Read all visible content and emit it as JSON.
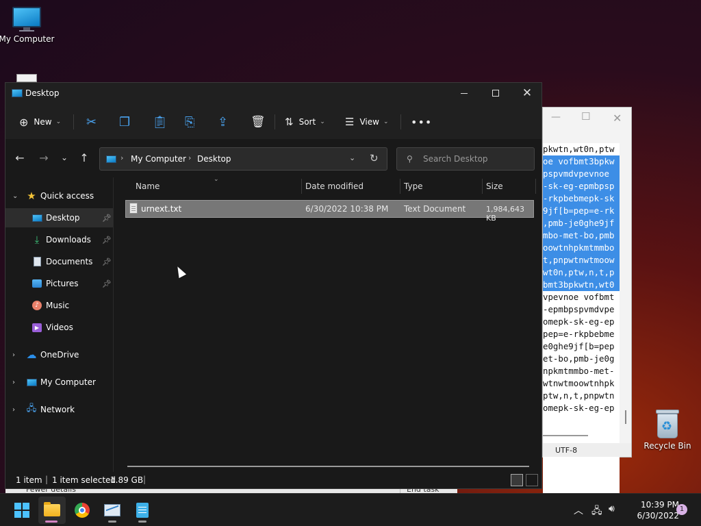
{
  "desktop": {
    "icons": [
      {
        "label": "My Computer"
      },
      {
        "label": "Recycle Bin"
      }
    ]
  },
  "notepad": {
    "lines": [
      "pkwtn,wt0n,ptw",
      "oe vofbmt3bpkw",
      "pspvmdvpevnoe",
      "-sk-eg-epmbpsp",
      "-rkpbebmepk-sk",
      "9jf[b=pep=e-rk",
      ",pmb-je0ghe9jf",
      "mbo-met-bo,pmb",
      "oowtnhpkmtmmbo",
      "t,pnpwtnwtmoow",
      "wt0n,ptw,n,t,p",
      "bmt3bpkwtn,wt0",
      "vpevnoe vofbmt",
      "-epmbpspvmdvpe",
      "omepk-sk-eg-ep",
      "pep=e-rkpbebme",
      "e0ghe9jf[b=pep",
      "et-bo,pmb-je0g",
      "npkmtmmbo-met-",
      "wtnwtmoowtnhpk",
      "ptw,n,t,pnpwtn",
      "omepk-sk-eg-ep"
    ],
    "selected_lines": [
      1,
      2,
      3,
      4,
      5,
      6,
      7,
      8,
      9,
      10,
      11
    ],
    "encoding": "UTF-8"
  },
  "taskmgr": {
    "fewer_details": "Fewer details",
    "end_task": "End task"
  },
  "explorer": {
    "title": "Desktop",
    "toolbar": {
      "new_label": "New",
      "sort_label": "Sort",
      "view_label": "View"
    },
    "breadcrumb": [
      "My Computer",
      "Desktop"
    ],
    "search_placeholder": "Search Desktop",
    "sidebar": {
      "quick_access": "Quick access",
      "items": [
        {
          "label": "Desktop"
        },
        {
          "label": "Downloads"
        },
        {
          "label": "Documents"
        },
        {
          "label": "Pictures"
        },
        {
          "label": "Music"
        },
        {
          "label": "Videos"
        }
      ],
      "onedrive": "OneDrive",
      "my_computer": "My Computer",
      "network": "Network"
    },
    "columns": {
      "name": "Name",
      "date": "Date modified",
      "type": "Type",
      "size": "Size"
    },
    "files": [
      {
        "name": "urnext.txt",
        "date": "6/30/2022 10:38 PM",
        "type": "Text Document",
        "size": "1,984,643 KB"
      }
    ],
    "status": {
      "items": "1 item",
      "selected": "1 item selected",
      "sel_size": "1.89 GB"
    }
  },
  "taskbar": {
    "time": "10:39 PM",
    "date": "6/30/2022",
    "notifications": "1"
  }
}
